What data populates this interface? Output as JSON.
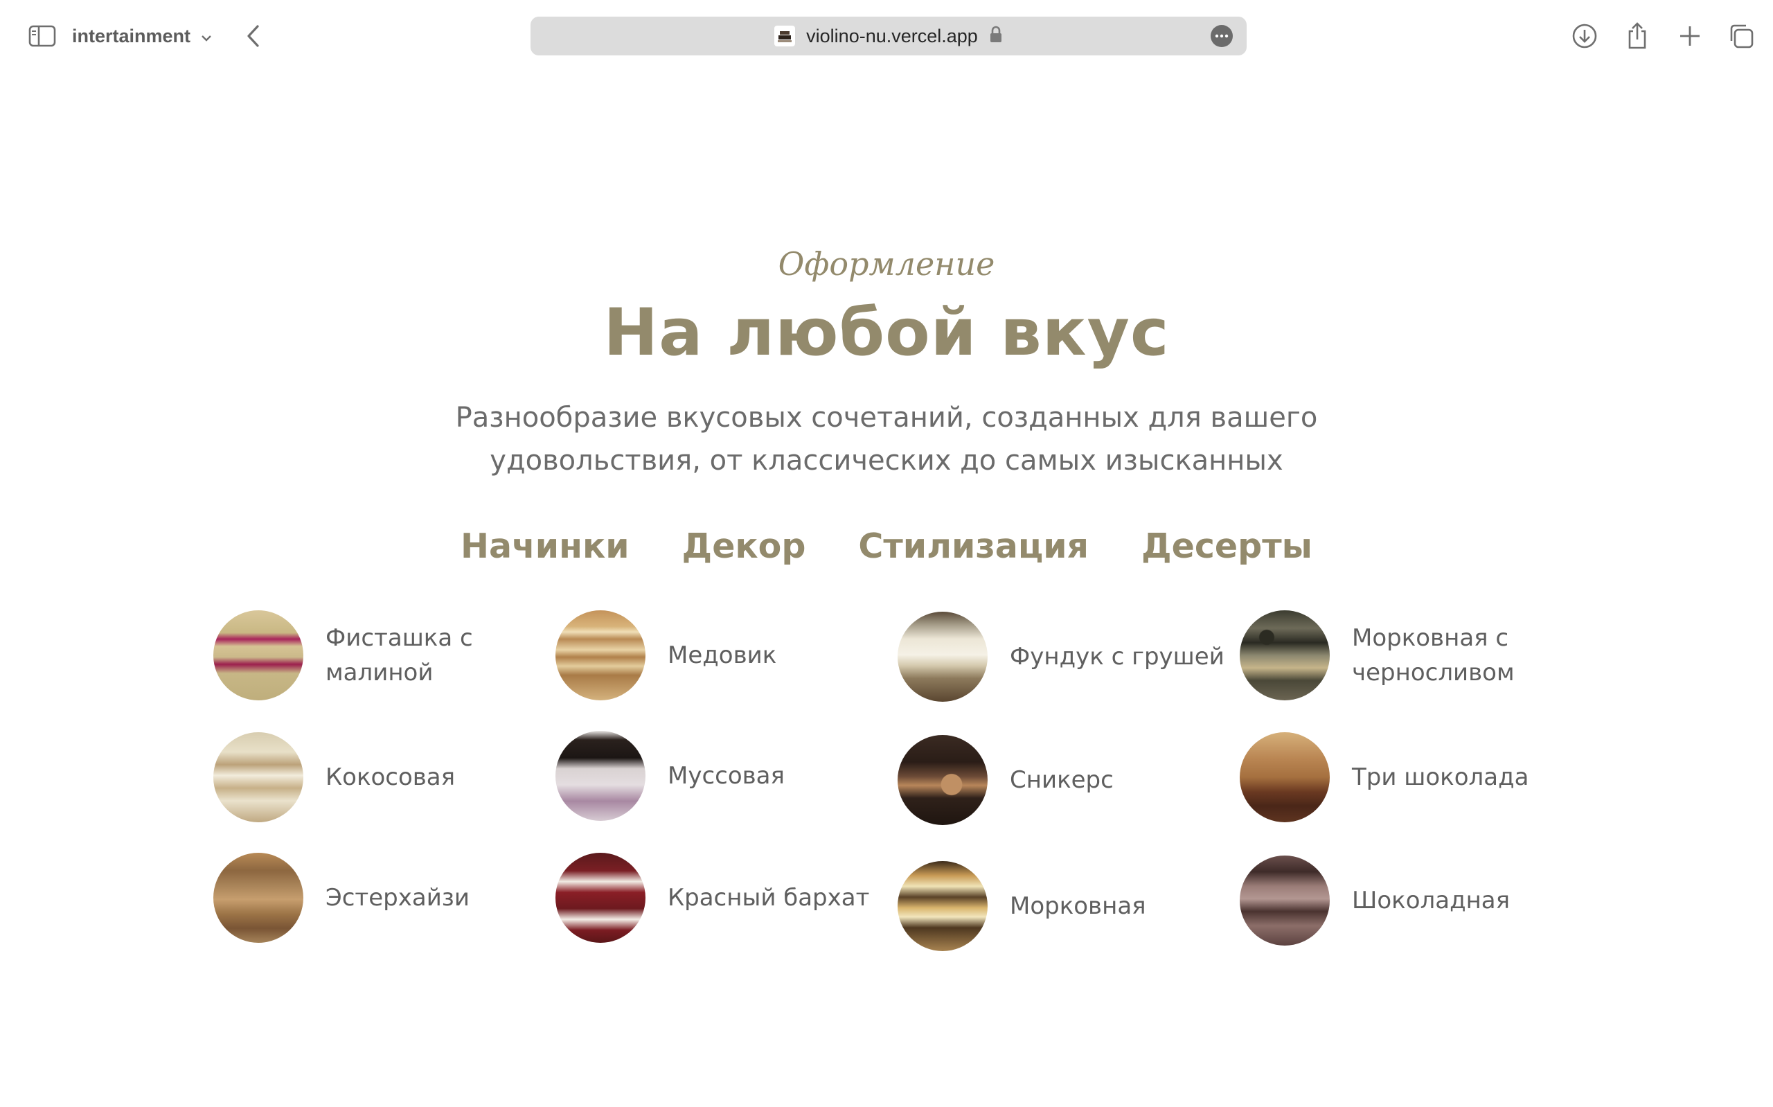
{
  "browser": {
    "tab_group": "intertainment",
    "url": "violino-nu.vercel.app"
  },
  "section": {
    "eyebrow": "Оформление",
    "title": "На любой вкус",
    "subtitle": "Разнообразие вкусовых сочетаний, созданных для вашего удовольствия, от классических до самых изысканных"
  },
  "tabs": [
    "Начинки",
    "Декор",
    "Стилизация",
    "Десерты"
  ],
  "flavors": [
    "Фисташка с малиной",
    "Медовик",
    "Фундук с грушей",
    "Морковная с черносливом",
    "Кокосовая",
    "Муссовая",
    "Сникерс",
    "Три шоколада",
    "Эстерхайзи",
    "Красный бархат",
    "Морковная",
    "Шоколадная"
  ],
  "colors": {
    "accent": "#938a6c",
    "text": "#6b6b6b",
    "address_bar": "#dcdcdc"
  }
}
